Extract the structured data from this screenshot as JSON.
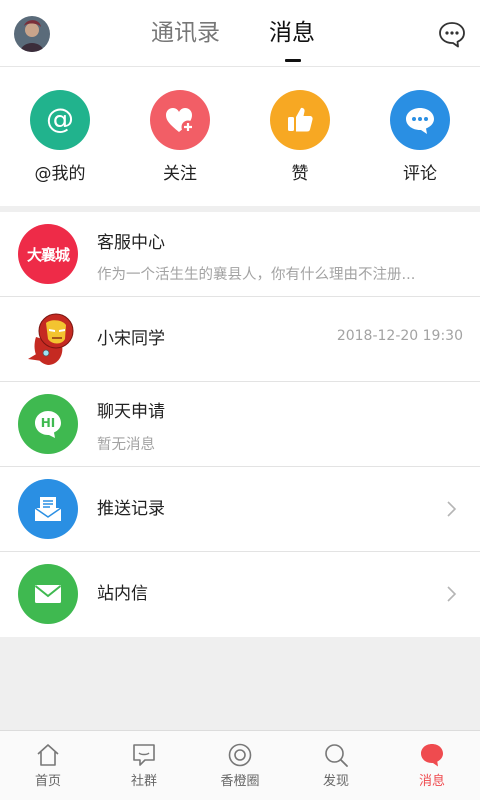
{
  "header": {
    "tabs": [
      {
        "label": "通讯录",
        "active": false
      },
      {
        "label": "消息",
        "active": true
      }
    ],
    "chat_icon": "chat-bubble-more-icon"
  },
  "quick_actions": [
    {
      "label": "@我的",
      "icon": "at-icon",
      "color": "#21b38d"
    },
    {
      "label": "关注",
      "icon": "heart-plus-icon",
      "color": "#f25e66"
    },
    {
      "label": "赞",
      "icon": "thumbs-up-icon",
      "color": "#f7a823"
    },
    {
      "label": "评论",
      "icon": "comment-icon",
      "color": "#2a8fe3"
    }
  ],
  "messages": [
    {
      "title": "客服中心",
      "subtitle": "作为一个活生生的襄县人，你有什么理由不注册...",
      "avatar_text": "大襄城",
      "avatar_color": "#ee2b48"
    },
    {
      "title": "小宋同学",
      "time": "2018-12-20 19:30",
      "avatar": "iron-man-avatar"
    },
    {
      "title": "聊天申请",
      "subtitle": "暂无消息",
      "avatar_text": "HI",
      "avatar_color": "#3fb950"
    },
    {
      "title": "推送记录",
      "icon": "inbox-icon",
      "color": "#2a8fe3"
    },
    {
      "title": "站内信",
      "icon": "envelope-icon",
      "color": "#3fb950"
    }
  ],
  "bottom_nav": [
    {
      "label": "首页",
      "icon": "home-icon",
      "active": false
    },
    {
      "label": "社群",
      "icon": "community-icon",
      "active": false
    },
    {
      "label": "香橙圈",
      "icon": "circle-icon",
      "active": false
    },
    {
      "label": "发现",
      "icon": "search-icon",
      "active": false
    },
    {
      "label": "消息",
      "icon": "message-icon",
      "active": true
    }
  ],
  "colors": {
    "accent": "#ef4b4f",
    "background": "#efefef"
  }
}
